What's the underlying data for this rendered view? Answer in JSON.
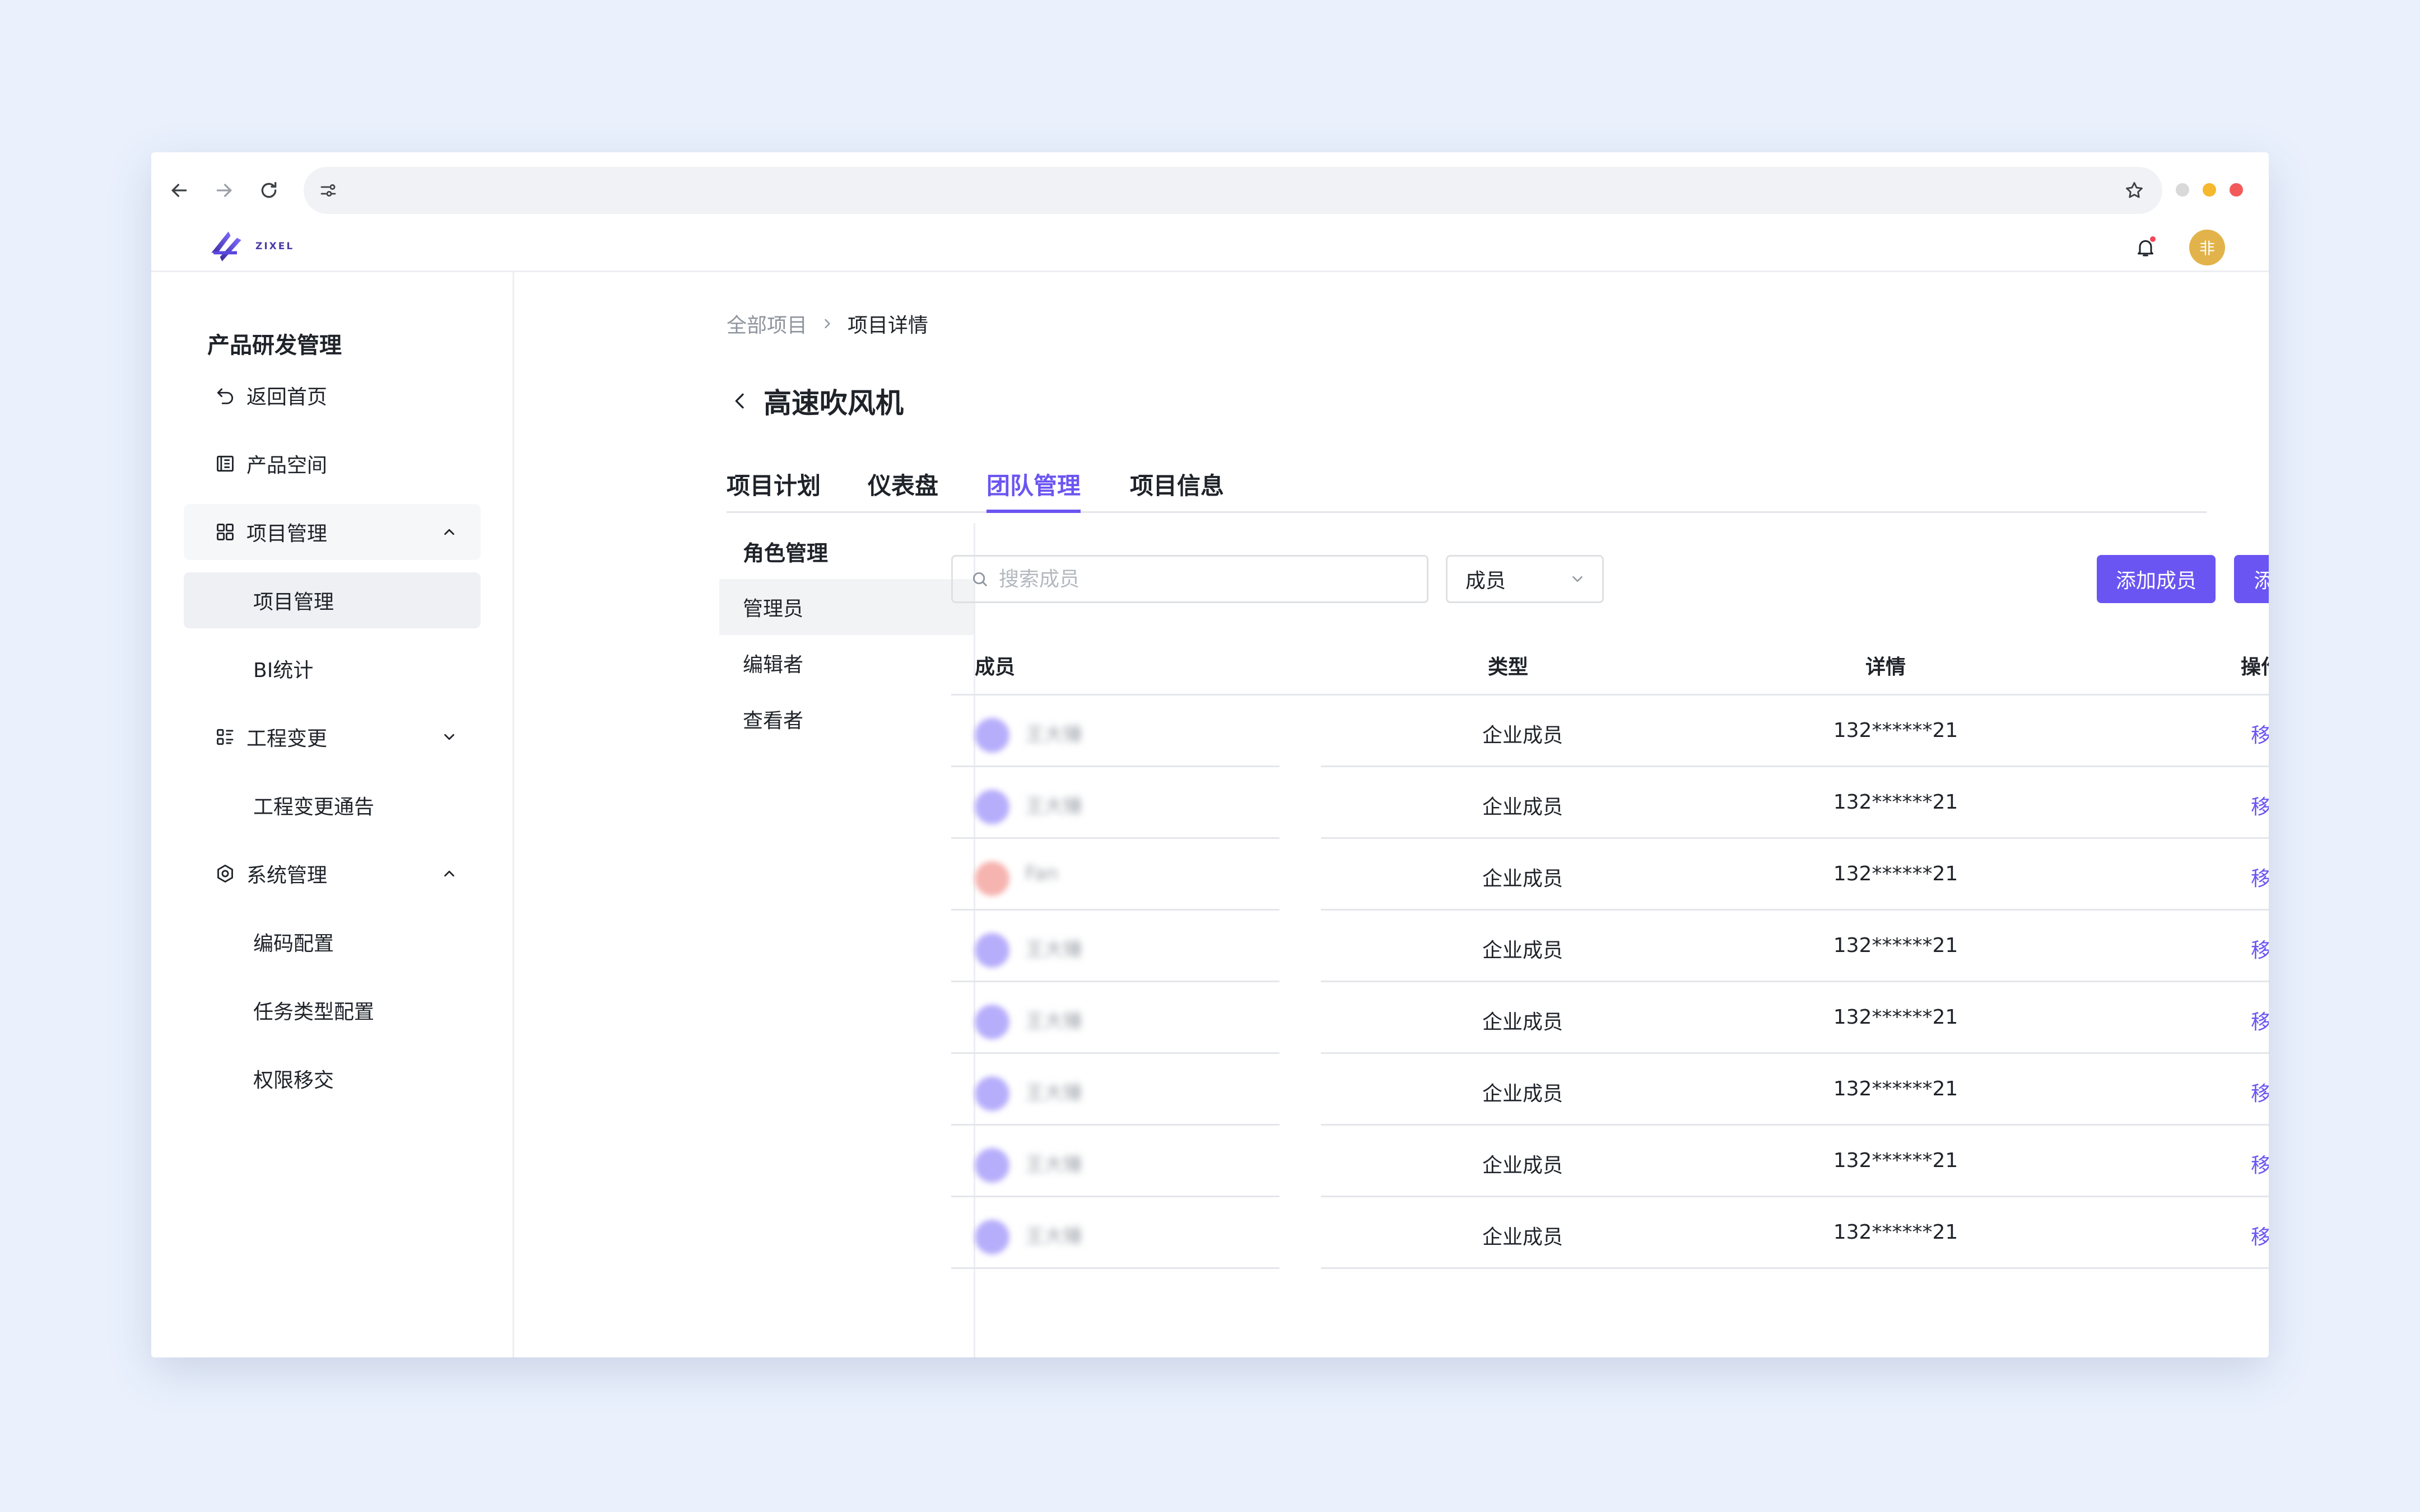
{
  "browser": {
    "url": "",
    "window_dots": [
      "#d9d9d9",
      "#f5b82e",
      "#f25a5a"
    ]
  },
  "header": {
    "logo_text": "ZIXEL",
    "avatar_text": "非",
    "notification_dot_color": "#f5455c"
  },
  "sidebar": {
    "title": "产品研发管理",
    "items": [
      {
        "label": "返回首页",
        "icon": "undo-icon"
      },
      {
        "label": "产品空间",
        "icon": "product-space-icon"
      },
      {
        "label": "项目管理",
        "icon": "grid-icon",
        "expanded": true
      },
      {
        "label": "项目管理",
        "sub": true,
        "active": true
      },
      {
        "label": "BI统计",
        "sub": true
      },
      {
        "label": "工程变更",
        "icon": "list-icon",
        "expanded": false
      },
      {
        "label": "工程变更通告",
        "sub": true
      },
      {
        "label": "系统管理",
        "icon": "gear-icon",
        "expanded": true
      },
      {
        "label": "编码配置",
        "sub": true
      },
      {
        "label": "任务类型配置",
        "sub": true
      },
      {
        "label": "权限移交",
        "sub": true
      }
    ]
  },
  "breadcrumb": {
    "root": "全部项目",
    "current": "项目详情"
  },
  "page": {
    "title": "高速吹风机"
  },
  "tabs": [
    "项目计划",
    "仪表盘",
    "团队管理",
    "项目信息"
  ],
  "active_tab": "团队管理",
  "roles": {
    "header": "角色管理",
    "items": [
      "管理员",
      "编辑者",
      "查看者"
    ],
    "active": "管理员"
  },
  "toolbar": {
    "search_placeholder": "搜索成员",
    "filter_value": "成员",
    "add_member": "添加成员",
    "add_group": "添加用户组"
  },
  "table": {
    "columns": [
      "成员",
      "类型",
      "详情",
      "操作"
    ],
    "rows": [
      {
        "name": "王大锤",
        "avatar_color": "#b7aefb",
        "type": "企业成员",
        "detail": "132******21",
        "action": "移除"
      },
      {
        "name": "王大锤",
        "avatar_color": "#b7aefb",
        "type": "企业成员",
        "detail": "132******21",
        "action": "移除"
      },
      {
        "name": "Fan",
        "avatar_color": "#f6b4b0",
        "type": "企业成员",
        "detail": "132******21",
        "action": "移除"
      },
      {
        "name": "王大锤",
        "avatar_color": "#b7aefb",
        "type": "企业成员",
        "detail": "132******21",
        "action": "移除"
      },
      {
        "name": "王大锤",
        "avatar_color": "#b7aefb",
        "type": "企业成员",
        "detail": "132******21",
        "action": "移除"
      },
      {
        "name": "王大锤",
        "avatar_color": "#b7aefb",
        "type": "企业成员",
        "detail": "132******21",
        "action": "移除"
      },
      {
        "name": "王大锤",
        "avatar_color": "#b7aefb",
        "type": "企业成员",
        "detail": "132******21",
        "action": "移除"
      },
      {
        "name": "王大锤",
        "avatar_color": "#b7aefb",
        "type": "企业成员",
        "detail": "132******21",
        "action": "移除"
      }
    ]
  },
  "colors": {
    "accent": "#6a55f2",
    "background": "#eaf1fd"
  }
}
